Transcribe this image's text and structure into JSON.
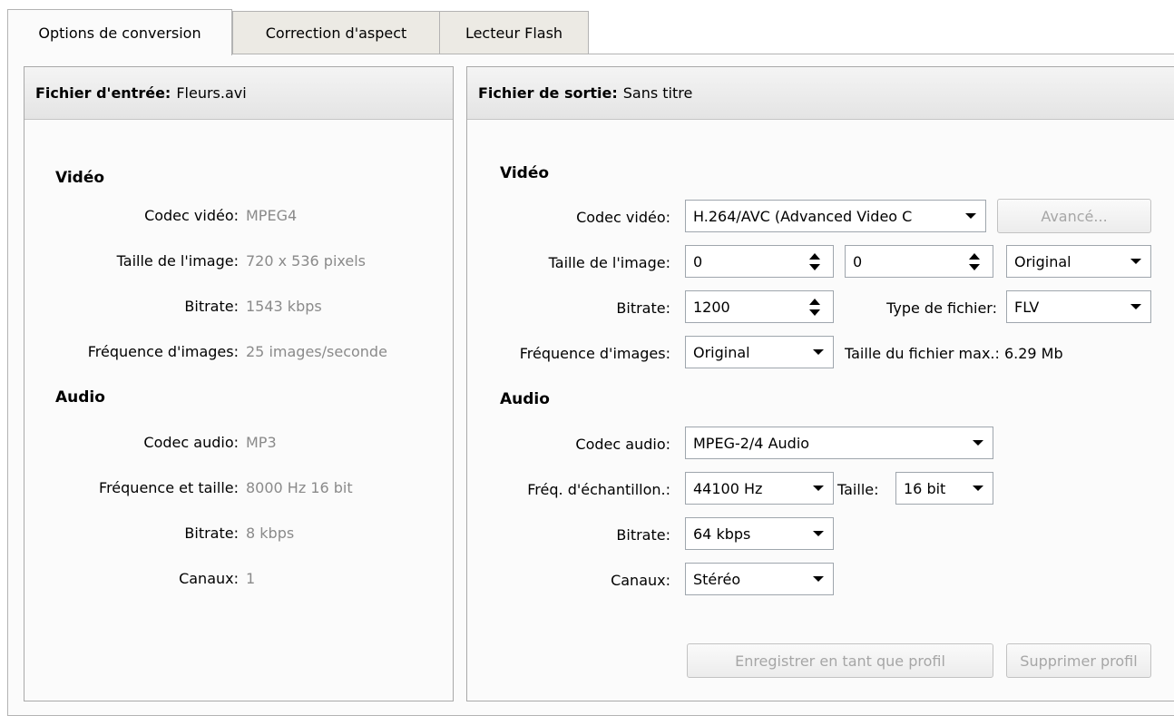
{
  "tabs": [
    "Options de conversion",
    "Correction d'aspect",
    "Lecteur Flash"
  ],
  "input": {
    "header_label": "Fichier d'entrée:",
    "header_value": "Fleurs.avi",
    "video_section": "Vidéo",
    "rows_video": [
      {
        "label": "Codec vidéo:",
        "value": "MPEG4"
      },
      {
        "label": "Taille de l'image:",
        "value": "720 x 536 pixels"
      },
      {
        "label": "Bitrate:",
        "value": "1543 kbps"
      },
      {
        "label": "Fréquence d'images:",
        "value": "25 images/seconde"
      }
    ],
    "audio_section": "Audio",
    "rows_audio": [
      {
        "label": "Codec audio:",
        "value": "MP3"
      },
      {
        "label": "Fréquence et taille:",
        "value": "8000 Hz 16 bit"
      },
      {
        "label": "Bitrate:",
        "value": "8 kbps"
      },
      {
        "label": "Canaux:",
        "value": "1"
      }
    ]
  },
  "output": {
    "header_label": "Fichier de sortie:",
    "header_value": "Sans titre",
    "video_section": "Vidéo",
    "codec_label": "Codec vidéo:",
    "codec_value": "H.264/AVC (Advanced Video C",
    "advanced_button": "Avancé...",
    "size_label": "Taille de l'image:",
    "width_value": "0",
    "height_value": "0",
    "size_preset": "Original",
    "bitrate_label": "Bitrate:",
    "bitrate_value": "1200",
    "filetype_label": "Type de fichier:",
    "filetype_value": "FLV",
    "framerate_label": "Fréquence d'images:",
    "framerate_value": "Original",
    "maxsize_text": "Taille du fichier max.:  6.29 Mb",
    "audio_section": "Audio",
    "audio_codec_label": "Codec audio:",
    "audio_codec_value": "MPEG-2/4 Audio",
    "samplerate_label": "Fréq. d'échantillon.:",
    "samplerate_value": "44100 Hz",
    "samplesize_label": "Taille:",
    "samplesize_value": "16 bit",
    "audio_bitrate_label": "Bitrate:",
    "audio_bitrate_value": "64 kbps",
    "channels_label": "Canaux:",
    "channels_value": "Stéréo",
    "save_profile_button": "Enregistrer en tant que profil",
    "delete_profile_button": "Supprimer profil"
  }
}
